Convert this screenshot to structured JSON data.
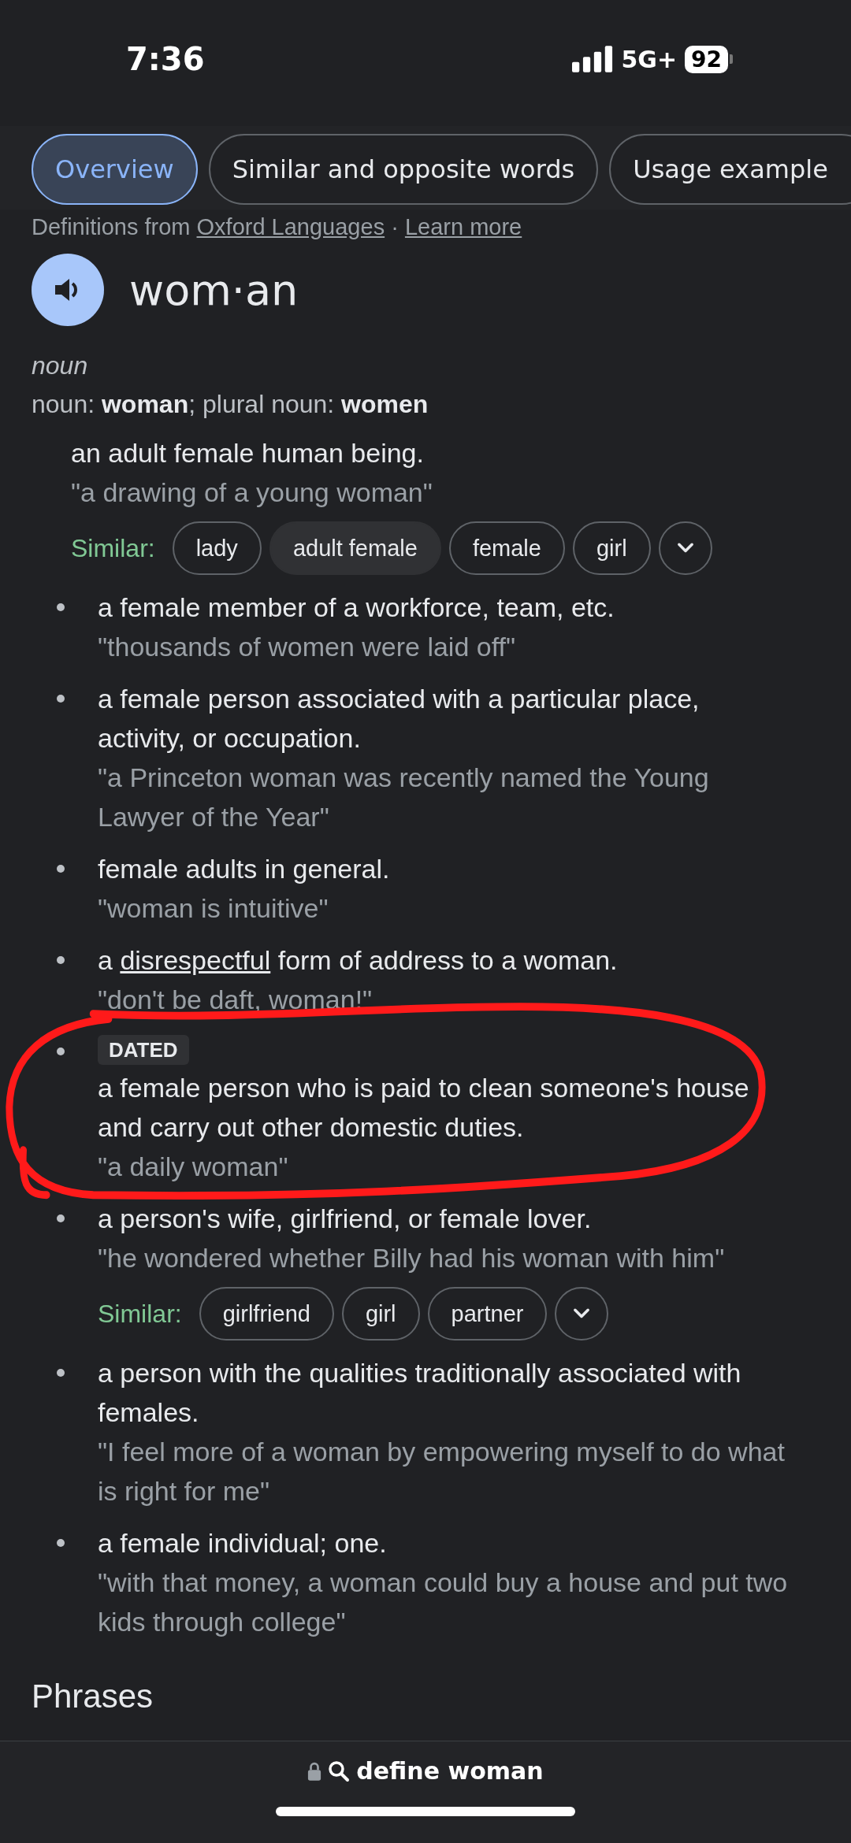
{
  "status_bar": {
    "time": "7:36",
    "network": "5G+",
    "battery": "92"
  },
  "tabs": [
    {
      "label": "Overview",
      "selected": true
    },
    {
      "label": "Similar and opposite words",
      "selected": false
    },
    {
      "label": "Usage example",
      "selected": false
    }
  ],
  "source": {
    "prefix": "Definitions from",
    "provider": "Oxford Languages",
    "separator": "·",
    "help_link": "Learn more"
  },
  "headword": "wom·an",
  "part_of_speech": "noun",
  "forms": "noun: **woman**; plural noun: **women**",
  "senses": [
    {
      "kind": "main",
      "definition": "an adult female human being.",
      "example": "\"a drawing of a young woman\"",
      "similar": {
        "label": "Similar:",
        "chips": [
          {
            "text": "lady",
            "selected": false
          },
          {
            "text": "adult female",
            "selected": true
          },
          {
            "text": "female",
            "selected": false
          },
          {
            "text": "girl",
            "selected": false
          }
        ]
      }
    },
    {
      "kind": "bullet",
      "definition": "a female member of a workforce, team, etc.",
      "example": "\"thousands of women were laid off\""
    },
    {
      "kind": "bullet",
      "definition": "a female person associated with a particular place, activity, or occupation.",
      "example": "\"a Princeton woman was recently named the Young Lawyer of the Year\""
    },
    {
      "kind": "bullet",
      "definition": "female adults in general.",
      "example": "\"woman is intuitive\""
    },
    {
      "kind": "bullet",
      "definition": "a",
      "link": "disrespectful",
      "definition_end": "form of address to a woman.",
      "example": "\"don't be daft, woman!\""
    },
    {
      "kind": "bullet",
      "tag": "DATED",
      "circled": true,
      "definition": "a female person who is paid to clean someone's house and carry out other domestic duties.",
      "example": "\"a daily woman\""
    },
    {
      "kind": "bullet",
      "definition": "a person's wife, girlfriend, or female lover.",
      "example": "\"he wondered whether Billy had his woman with him\"",
      "similar": {
        "label": "Similar:",
        "chips": [
          {
            "text": "girlfriend",
            "selected": false
          },
          {
            "text": "girl",
            "selected": false
          },
          {
            "text": "partner",
            "selected": false
          }
        ]
      }
    },
    {
      "kind": "bullet",
      "definition": "a person with the qualities traditionally associated with females.",
      "example": "\"I feel more of a woman by empowering myself to do what is right for me\""
    },
    {
      "kind": "bullet",
      "definition": "a female individual; one.",
      "example": "\"with that money, a woman could buy a house and put two kids through college\""
    }
  ],
  "section_heading": "Phrases",
  "address_bar": {
    "query": "define woman"
  }
}
